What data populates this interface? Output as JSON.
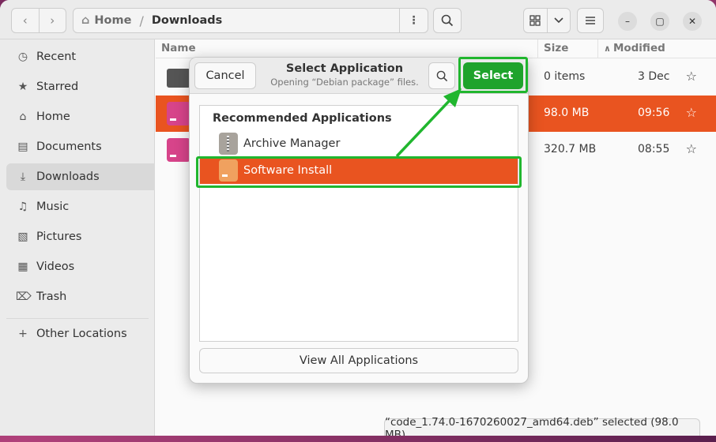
{
  "headerbar": {
    "path": {
      "home_label": "Home",
      "separator": "/",
      "current_label": "Downloads"
    }
  },
  "sidebar": {
    "items": [
      {
        "label": "Recent",
        "icon": "clock-icon"
      },
      {
        "label": "Starred",
        "icon": "star-icon"
      },
      {
        "label": "Home",
        "icon": "home-icon"
      },
      {
        "label": "Documents",
        "icon": "document-icon"
      },
      {
        "label": "Downloads",
        "icon": "download-icon",
        "active": true
      },
      {
        "label": "Music",
        "icon": "music-icon"
      },
      {
        "label": "Pictures",
        "icon": "picture-icon"
      },
      {
        "label": "Videos",
        "icon": "video-icon"
      },
      {
        "label": "Trash",
        "icon": "trash-icon"
      },
      {
        "label": "Other Locations",
        "icon": "plus-icon"
      }
    ]
  },
  "filelist": {
    "columns": {
      "name": "Name",
      "size": "Size",
      "modified": "Modified"
    },
    "rows": [
      {
        "size": "0 items",
        "modified": "3 Dec",
        "type": "folder"
      },
      {
        "size": "98.0 MB",
        "modified": "09:56",
        "type": "deb",
        "selected": true
      },
      {
        "size": "320.7 MB",
        "modified": "08:55",
        "type": "deb"
      }
    ]
  },
  "status": {
    "text": "“code_1.74.0-1670260027_amd64.deb” selected (98.0 MB)"
  },
  "dialog": {
    "cancel_label": "Cancel",
    "title": "Select Application",
    "subtitle": "Opening “Debian package” files.",
    "select_label": "Select",
    "recommended_heading": "Recommended Applications",
    "apps": [
      {
        "label": "Archive Manager",
        "icon": "archive-manager-icon"
      },
      {
        "label": "Software Install",
        "icon": "software-install-icon",
        "selected": true
      }
    ],
    "view_all_label": "View All Applications"
  },
  "colors": {
    "accent": "#e95420",
    "highlight_green": "#20b62e",
    "select_button": "#1fa32c"
  }
}
